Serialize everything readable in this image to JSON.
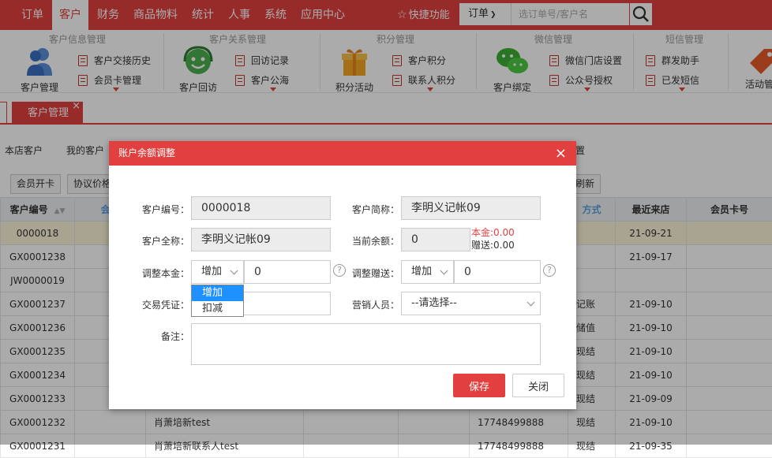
{
  "nav": {
    "items": [
      "订单",
      "客户",
      "财务",
      "商品物料",
      "统计",
      "人事",
      "系统",
      "应用中心"
    ],
    "active_index": 1,
    "quick": "快捷功能",
    "search_type": "订单",
    "search_placeholder": "选订单号/客户名"
  },
  "ribbon": {
    "groups": [
      "客户信息管理",
      "客户关系管理",
      "积分管理",
      "微信管理",
      "短信管理"
    ],
    "big_tools": [
      "客户管理",
      "客户回访",
      "积分活动",
      "客户绑定",
      "活动管"
    ],
    "small_tools": [
      "客户交接历史",
      "会员卡管理",
      "回访记录",
      "客户公海",
      "客户积分",
      "联系人积分",
      "微信门店设置",
      "公众号授权",
      "群发助手",
      "已发短信"
    ]
  },
  "tabs": {
    "active": "客户管理",
    "close": "×"
  },
  "page": {
    "subtabs": [
      "本店客户",
      "我的客户"
    ],
    "right_label": "置",
    "buttons": [
      "会员开卡",
      "协议价格"
    ],
    "refresh": "刷新",
    "columns": [
      "客户编号",
      "会员",
      "方式",
      "最近来店",
      "会员卡号"
    ],
    "rows": [
      {
        "id": "0000018",
        "name": "",
        "phone": "",
        "method": "",
        "date": "21-09-21"
      },
      {
        "id": "GX0001238",
        "name": "",
        "phone": "",
        "method": "",
        "date": "21-09-17"
      },
      {
        "id": "JW0000019",
        "name": "",
        "phone": "",
        "method": "",
        "date": ""
      },
      {
        "id": "GX0001237",
        "name": "",
        "phone": "",
        "method": "记账",
        "date": "21-09-10"
      },
      {
        "id": "GX0001236",
        "name": "",
        "phone": "",
        "method": "储值",
        "date": "21-09-10"
      },
      {
        "id": "GX0001235",
        "name": "",
        "phone": "",
        "method": "现结",
        "date": "21-09-10"
      },
      {
        "id": "GX0001234",
        "name": "",
        "phone": "",
        "method": "现结",
        "date": "21-09-10"
      },
      {
        "id": "GX0001233",
        "name": "",
        "phone": "",
        "method": "现结",
        "date": "21-09-09"
      },
      {
        "id": "GX0001232",
        "name": "肖萧培新test",
        "phone": "17748499888",
        "method": "现结",
        "date": "21-09-10"
      },
      {
        "id": "GX0001231",
        "name": "肖萧培新联系人test",
        "phone": "17748499888",
        "method": "现结",
        "date": "21-09-35"
      }
    ]
  },
  "modal": {
    "title": "账户余额调整",
    "close": "×",
    "labels": {
      "cust_no": "客户编号：",
      "cust_short": "客户简称：",
      "cust_full": "客户全称：",
      "cur_balance": "当前余额：",
      "adjust_principal": "调整本金：",
      "adjust_gift": "调整赠送：",
      "voucher": "交易凭证：",
      "sales": "营销人员：",
      "remark": "备注："
    },
    "values": {
      "cust_no": "0000018",
      "cust_short": "李明义记帐09",
      "cust_full": "李明义记帐09",
      "cur_balance": "0",
      "principal_mode": "增加",
      "principal_amount": "0",
      "gift_mode": "增加",
      "gift_amount": "0",
      "voucher": "",
      "sales": "--请选择--",
      "remark": ""
    },
    "balance_note": {
      "principal": "本金:0.00",
      "gift": "赠送:0.00"
    },
    "dropdown_options": [
      "增加",
      "扣减"
    ],
    "save": "保存",
    "cancel": "关闭",
    "help": "?",
    "colors": {
      "accent": "#e2403f",
      "highlight": "#1e90ff"
    }
  }
}
